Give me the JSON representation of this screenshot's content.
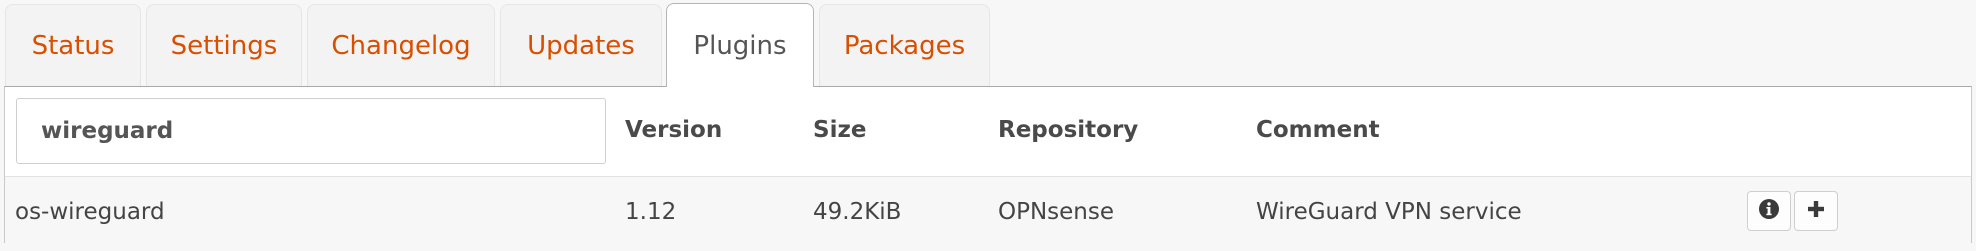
{
  "tabs": [
    {
      "label": "Status",
      "active": false
    },
    {
      "label": "Settings",
      "active": false
    },
    {
      "label": "Changelog",
      "active": false
    },
    {
      "label": "Updates",
      "active": false
    },
    {
      "label": "Plugins",
      "active": true
    },
    {
      "label": "Packages",
      "active": false
    }
  ],
  "search": {
    "value": "wireguard",
    "placeholder": ""
  },
  "table": {
    "columns": [
      "Version",
      "Size",
      "Repository",
      "Comment"
    ],
    "rows": [
      {
        "name": "os-wireguard",
        "version": "1.12",
        "size": "49.2KiB",
        "repository": "OPNsense",
        "comment": "WireGuard VPN service"
      }
    ]
  },
  "icons": {
    "info": "info-circle-icon",
    "add": "plus-icon"
  },
  "colors": {
    "tab_link": "#d94f00",
    "active_tab_text": "#555555"
  }
}
